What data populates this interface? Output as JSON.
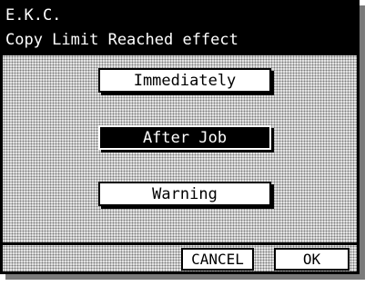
{
  "header": {
    "title": "E.K.C.",
    "subtitle": "Copy Limit Reached effect"
  },
  "options": [
    {
      "label": "Immediately",
      "selected": false
    },
    {
      "label": "After Job",
      "selected": true
    },
    {
      "label": "Warning",
      "selected": false
    }
  ],
  "footer": {
    "cancel_label": "CANCEL",
    "ok_label": "OK"
  }
}
